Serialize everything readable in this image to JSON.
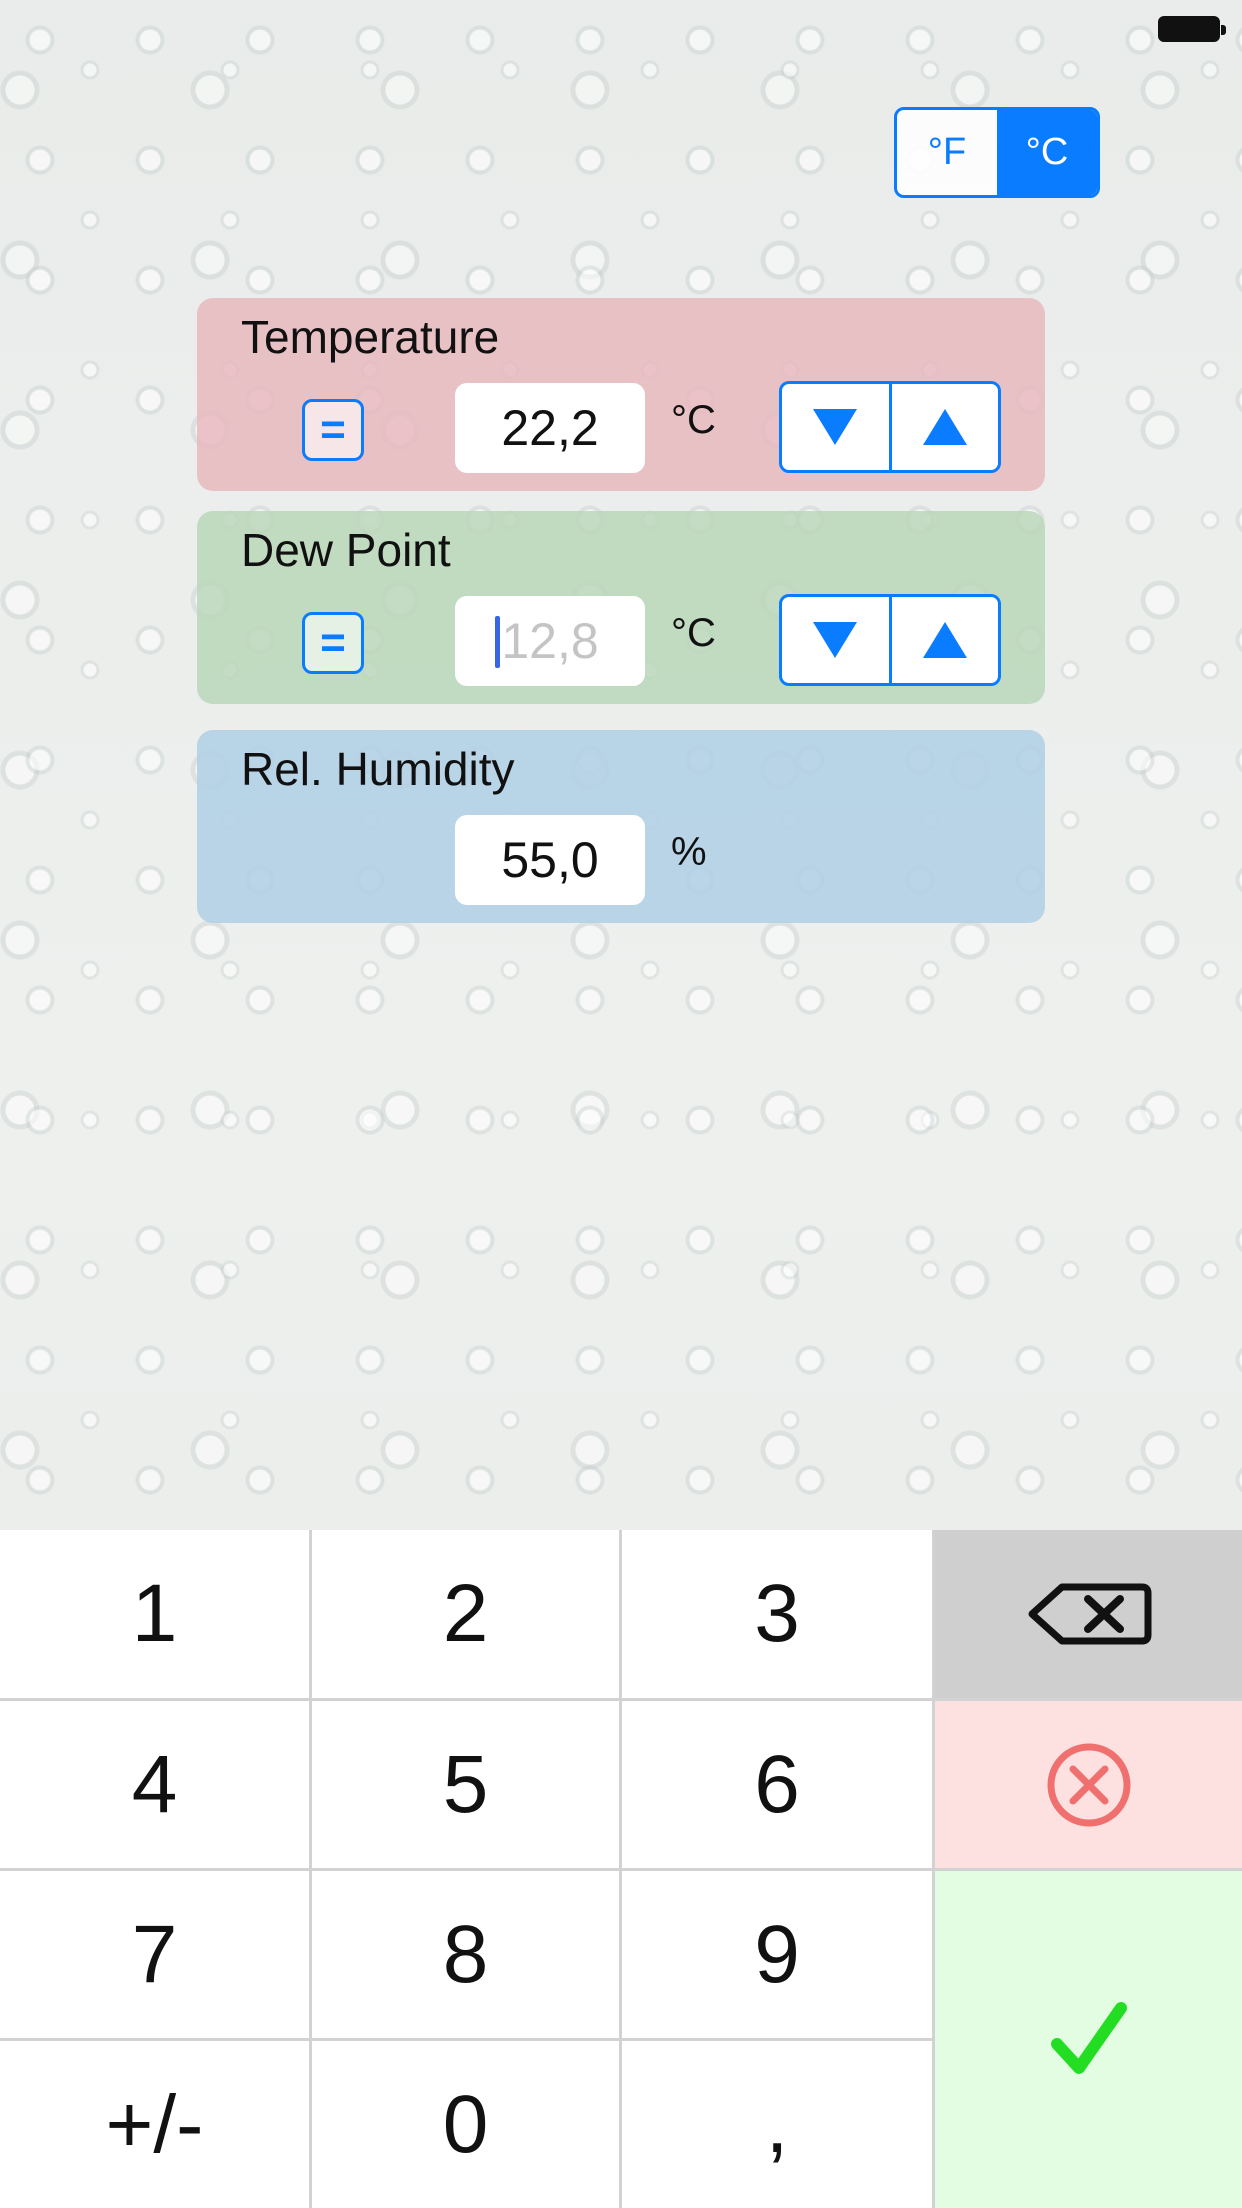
{
  "unit_toggle": {
    "fahrenheit_label": "°F",
    "celsius_label": "°C",
    "selected": "°C"
  },
  "panels": {
    "temperature": {
      "title": "Temperature",
      "value": "22,2",
      "unit": "°C"
    },
    "dew_point": {
      "title": "Dew Point",
      "placeholder": "12,8",
      "unit": "°C"
    },
    "humidity": {
      "title": "Rel. Humidity",
      "value": "55,0",
      "unit": "%"
    }
  },
  "keypad": {
    "keys": [
      "1",
      "2",
      "3",
      "4",
      "5",
      "6",
      "7",
      "8",
      "9",
      "+/-",
      "0",
      ","
    ],
    "actions": [
      "backspace-icon",
      "clear-icon",
      "checkmark-icon"
    ]
  },
  "colors": {
    "accent": "#0a7cff",
    "temperature_panel": "#e8b9be",
    "dew_point_panel": "#bad7ba",
    "humidity_panel": "#b2d0e6",
    "clear_key": "#fde1e1",
    "ok_key": "#e2fde2",
    "check": "#22dd22",
    "clear_icon": "#f07070"
  }
}
